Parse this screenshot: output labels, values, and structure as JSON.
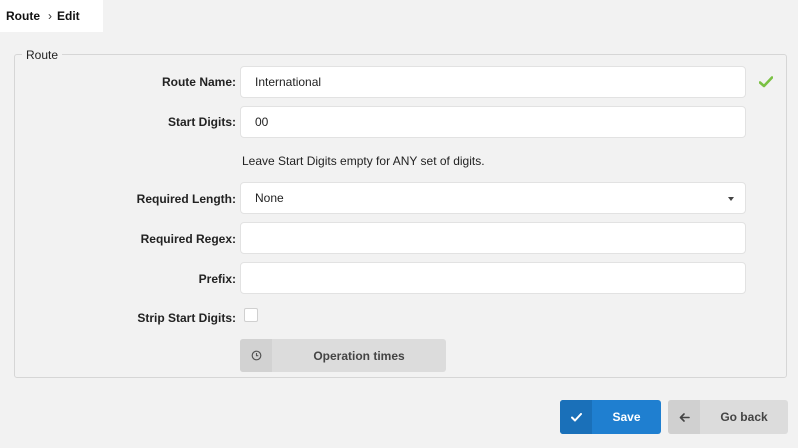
{
  "breadcrumb": {
    "root": "Route",
    "separator": "›",
    "current": "Edit"
  },
  "form": {
    "legend": "Route",
    "route_name": {
      "label": "Route Name:",
      "value": "International"
    },
    "start_digits": {
      "label": "Start Digits:",
      "value": "00"
    },
    "hint": "Leave Start Digits empty for ANY set of digits.",
    "required_length": {
      "label": "Required Length:",
      "value": "None"
    },
    "required_regex": {
      "label": "Required Regex:",
      "value": ""
    },
    "prefix": {
      "label": "Prefix:",
      "value": ""
    },
    "strip_start_digits": {
      "label": "Strip Start Digits:",
      "checked": false
    },
    "operation_times_label": "Operation times"
  },
  "actions": {
    "save_label": "Save",
    "back_label": "Go back"
  },
  "colors": {
    "accent": "#1f7fd0",
    "valid": "#7ac143"
  },
  "icons": {
    "valid": "checkmark-icon",
    "clock": "clock-icon",
    "save": "checkmark-icon",
    "back": "arrow-left-icon",
    "dropdown": "caret-down-icon"
  }
}
